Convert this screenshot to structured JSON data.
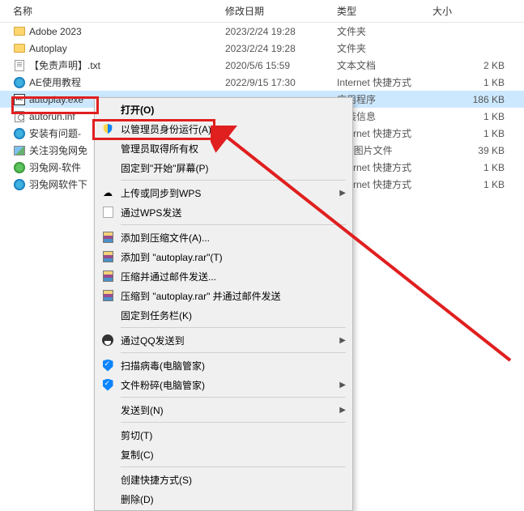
{
  "columns": {
    "name": "名称",
    "date": "修改日期",
    "type": "类型",
    "size": "大小"
  },
  "files": [
    {
      "name": "Adobe 2023",
      "date": "2023/2/24 19:28",
      "type": "文件夹",
      "size": "",
      "icon": "folder"
    },
    {
      "name": "Autoplay",
      "date": "2023/2/24 19:28",
      "type": "文件夹",
      "size": "",
      "icon": "folder"
    },
    {
      "name": "【免责声明】.txt",
      "date": "2020/5/6 15:59",
      "type": "文本文档",
      "size": "2 KB",
      "icon": "txt"
    },
    {
      "name": "AE使用教程",
      "date": "2022/9/15 17:30",
      "type": "Internet 快捷方式",
      "size": "1 KB",
      "icon": "ie"
    },
    {
      "name": "autoplay.exe",
      "date": "",
      "type": "应用程序",
      "size": "186 KB",
      "icon": "adobe",
      "selected": true
    },
    {
      "name": "autorun.inf",
      "date": "",
      "type": "安装信息",
      "size": "1 KB",
      "icon": "inf"
    },
    {
      "name": "安装有问题-",
      "date": "",
      "type": "Internet 快捷方式",
      "size": "1 KB",
      "icon": "ie"
    },
    {
      "name": "关注羽兔网免",
      "date": "",
      "type": "PG 图片文件",
      "size": "39 KB",
      "icon": "jpg"
    },
    {
      "name": "羽兔网-软件",
      "date": "",
      "type": "Internet 快捷方式",
      "size": "1 KB",
      "icon": "url"
    },
    {
      "name": "羽兔网软件下",
      "date": "",
      "type": "Internet 快捷方式",
      "size": "1 KB",
      "icon": "ie"
    }
  ],
  "menu": {
    "open": "打开(O)",
    "run_as_admin": "以管理员身份运行(A)",
    "admin_ownership": "管理员取得所有权",
    "pin_start": "固定到\"开始\"屏幕(P)",
    "wps_upload": "上传或同步到WPS",
    "wps_send": "通过WPS发送",
    "add_archive": "添加到压缩文件(A)...",
    "add_rar": "添加到 \"autoplay.rar\"(T)",
    "compress_email": "压缩并通过邮件发送...",
    "compress_rar_email": "压缩到 \"autoplay.rar\" 并通过邮件发送",
    "pin_taskbar": "固定到任务栏(K)",
    "qq_send": "通过QQ发送到",
    "scan_virus": "扫描病毒(电脑管家)",
    "shred_file": "文件粉碎(电脑管家)",
    "send_to": "发送到(N)",
    "cut": "剪切(T)",
    "copy": "复制(C)",
    "create_shortcut": "创建快捷方式(S)",
    "delete": "删除(D)"
  }
}
